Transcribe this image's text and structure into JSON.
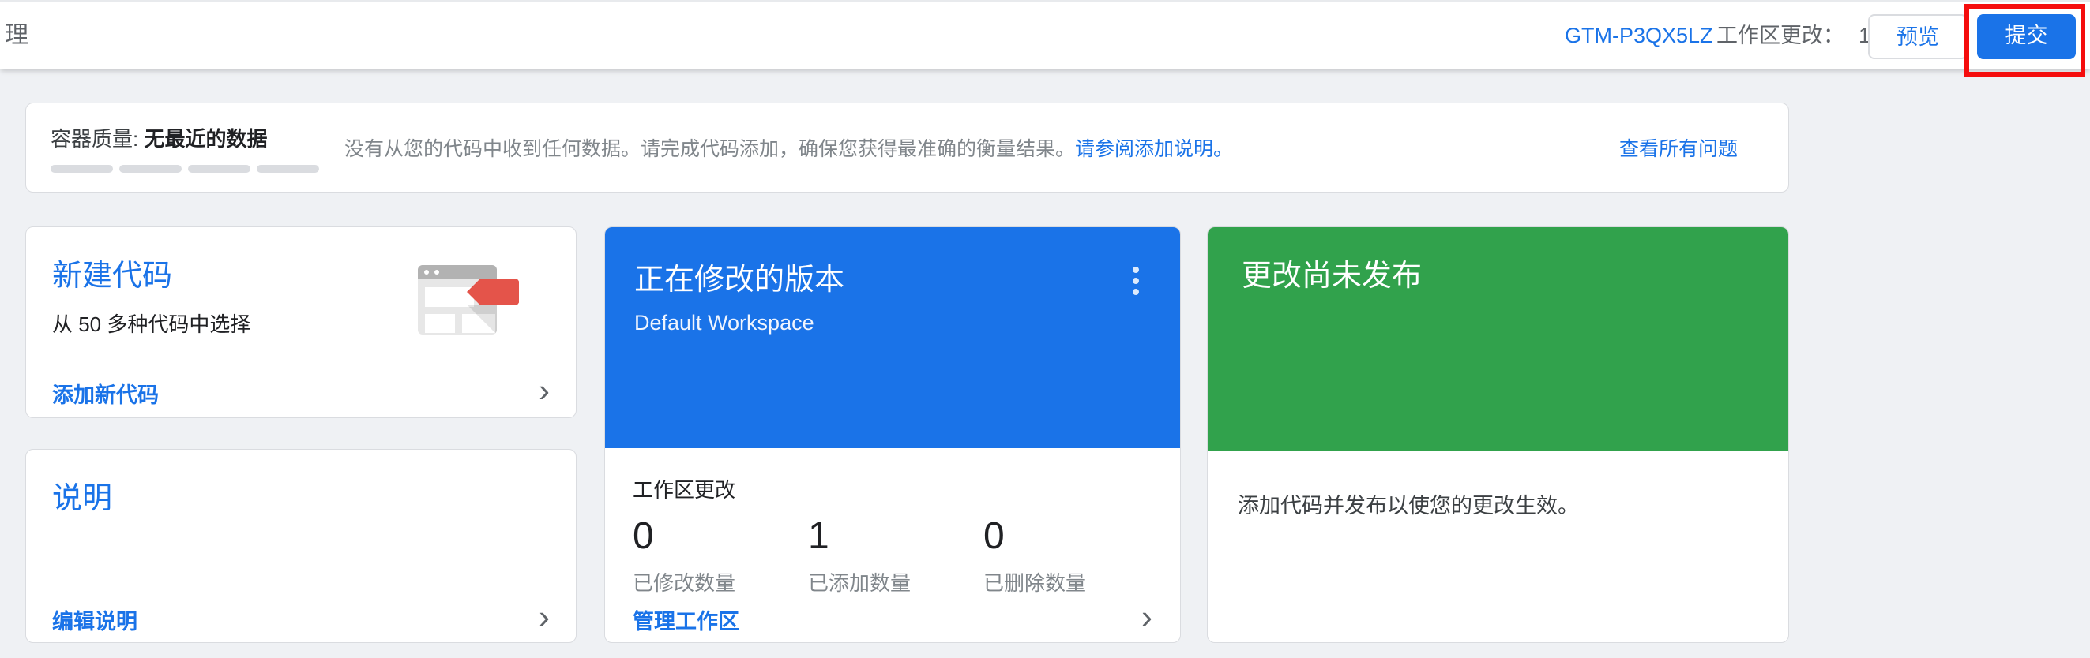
{
  "topbar": {
    "partial_tab_label": "理",
    "container_id": "GTM-P3QX5LZ",
    "changes_label": "工作区更改：",
    "changes_count": "1",
    "preview_label": "预览",
    "submit_label": "提交"
  },
  "banner": {
    "quality_label": "容器质量:",
    "quality_value": "无最近的数据",
    "segment_count": 4,
    "message": "没有从您的代码中收到任何数据。请完成代码添加，确保您获得最准确的衡量结果。",
    "inline_link": "请参阅添加说明。",
    "view_all_link": "查看所有问题"
  },
  "cards": {
    "new_tag": {
      "title": "新建代码",
      "subtitle": "从 50 多种代码中选择",
      "action": "添加新代码"
    },
    "description": {
      "title": "说明",
      "action": "编辑说明"
    },
    "workspace": {
      "title": "正在修改的版本",
      "subtitle": "Default Workspace",
      "section_label": "工作区更改",
      "stats": [
        {
          "value": "0",
          "label": "已修改数量"
        },
        {
          "value": "1",
          "label": "已添加数量"
        },
        {
          "value": "0",
          "label": "已删除数量"
        }
      ],
      "action": "管理工作区"
    },
    "unpublished": {
      "title": "更改尚未发布",
      "body": "添加代码并发布以使您的更改生效。"
    }
  },
  "icons": {
    "more_options": "kebab-vertical",
    "chevron": "chevron-right",
    "new_tag_art": "browser-window-with-red-tag"
  },
  "colors": {
    "accent_blue": "#1a73e8",
    "published_green": "#31a24c",
    "tag_red": "#e4544a",
    "annotation_red": "#f50d0d"
  }
}
